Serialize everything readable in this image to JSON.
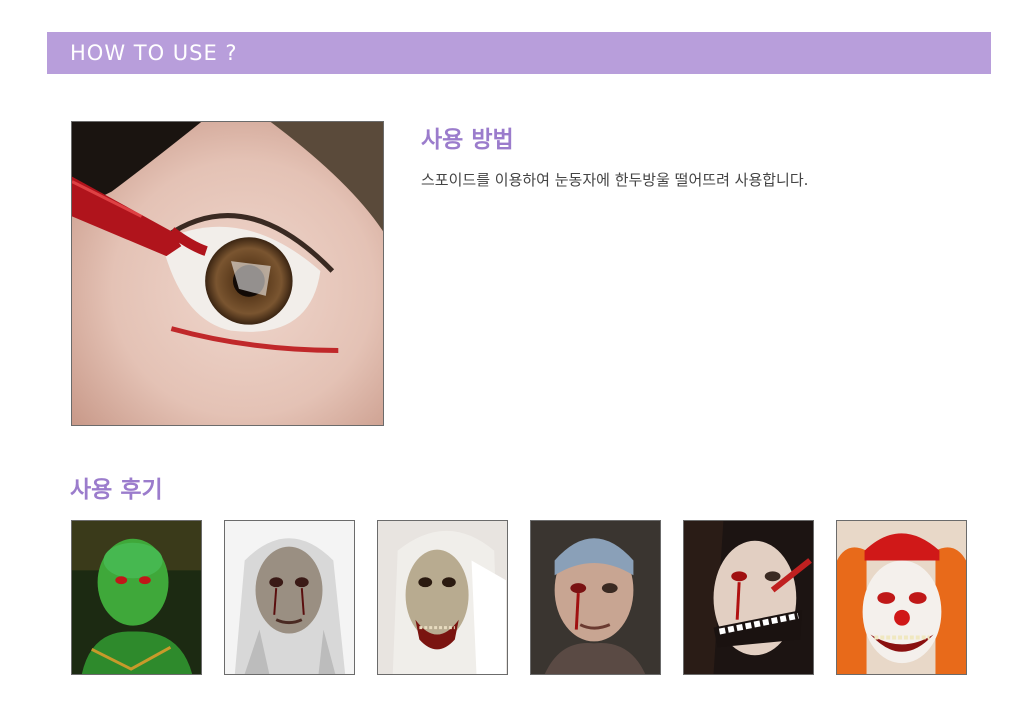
{
  "header": {
    "title": "HOW TO USE ?",
    "bar_color": "#b89edb"
  },
  "usage": {
    "title": "사용 방법",
    "description": "스포이드를 이용하여 눈동자에 한두방울 떨어뜨려 사용합니다.",
    "accent_color": "#9b7ccc"
  },
  "reviews": {
    "title": "사용 후기"
  },
  "images": {
    "main": "eye-dropper-photo",
    "thumbnails": [
      "green-face-makeup-photo",
      "pale-ghoul-makeup-photo",
      "rotting-zombie-bride-photo",
      "tattooed-man-bleeding-eye-photo",
      "skull-mouth-makeup-photo",
      "clown-makeup-photo"
    ]
  }
}
